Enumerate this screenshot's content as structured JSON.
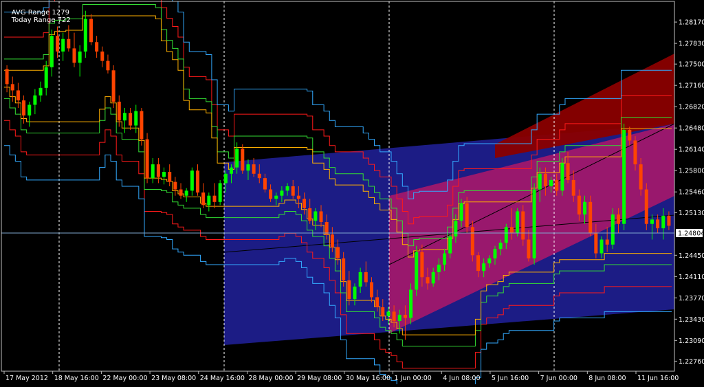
{
  "header": {
    "avg_range_label": "AVG Range 1279",
    "today_range_label": "Today Range 722"
  },
  "colors": {
    "background": "#000000",
    "frame": "#c0c0c0",
    "text": "#ffffff",
    "bull": "#00ff00",
    "bear": "#ff4400",
    "band_red": "#ff1a1a",
    "band_green": "#33dd33",
    "band_orange": "#ffb000",
    "band_blue": "#33aaff",
    "channel_blue": "#1e1e8c",
    "channel_pink": "#a0186c",
    "channel_red": "#8a0000",
    "current_price_line": "#7fa8d0"
  },
  "chart_data": {
    "type": "candlestick",
    "instrument_timeframe": "",
    "current_price": "1.24804",
    "y_ticks": [
      "1.28170",
      "1.27830",
      "1.27500",
      "1.27160",
      "1.26820",
      "1.26480",
      "1.26140",
      "1.25800",
      "1.25460",
      "1.25130",
      "1.24450",
      "1.24110",
      "1.23770",
      "1.23430",
      "1.23090",
      "1.22760"
    ],
    "ylim": [
      1.226,
      1.285
    ],
    "x_ticks": [
      "17 May 2012",
      "18 May 16:00",
      "22 May 00:00",
      "23 May 08:00",
      "24 May 16:00",
      "28 May 00:00",
      "29 May 08:00",
      "30 May 16:00",
      "1 Jun 00:00",
      "4 Jun 08:00",
      "5 Jun 16:00",
      "7 Jun 00:00",
      "8 Jun 08:00",
      "11 Jun 16:00"
    ],
    "candles": [
      [
        1.2742,
        1.2748,
        1.2705,
        1.2718
      ],
      [
        1.2718,
        1.273,
        1.269,
        1.2708
      ],
      [
        1.2708,
        1.272,
        1.268,
        1.2692
      ],
      [
        1.2692,
        1.27,
        1.2655,
        1.2668
      ],
      [
        1.2668,
        1.269,
        1.265,
        1.2685
      ],
      [
        1.2685,
        1.271,
        1.267,
        1.27
      ],
      [
        1.27,
        1.2722,
        1.269,
        1.2712
      ],
      [
        1.2712,
        1.2755,
        1.27,
        1.2745
      ],
      [
        1.2745,
        1.2805,
        1.273,
        1.2795
      ],
      [
        1.2795,
        1.281,
        1.276,
        1.277
      ],
      [
        1.277,
        1.28,
        1.2755,
        1.279
      ],
      [
        1.279,
        1.2812,
        1.277,
        1.2775
      ],
      [
        1.2775,
        1.28,
        1.2745,
        1.2752
      ],
      [
        1.2752,
        1.278,
        1.273,
        1.277
      ],
      [
        1.277,
        1.2835,
        1.276,
        1.2822
      ],
      [
        1.2822,
        1.283,
        1.278,
        1.2785
      ],
      [
        1.2785,
        1.2795,
        1.276,
        1.277
      ],
      [
        1.277,
        1.2778,
        1.2745,
        1.2755
      ],
      [
        1.2755,
        1.2765,
        1.2735,
        1.274
      ],
      [
        1.274,
        1.2748,
        1.268,
        1.269
      ],
      [
        1.269,
        1.27,
        1.265,
        1.266
      ],
      [
        1.266,
        1.268,
        1.264,
        1.2672
      ],
      [
        1.2672,
        1.268,
        1.2645,
        1.2652
      ],
      [
        1.2652,
        1.2685,
        1.264,
        1.2675
      ],
      [
        1.2675,
        1.268,
        1.262,
        1.263
      ],
      [
        1.263,
        1.264,
        1.256,
        1.2568
      ],
      [
        1.2568,
        1.26,
        1.256,
        1.259
      ],
      [
        1.259,
        1.26,
        1.256,
        1.257
      ],
      [
        1.257,
        1.2585,
        1.2558,
        1.2578
      ],
      [
        1.2578,
        1.259,
        1.2555,
        1.2562
      ],
      [
        1.2562,
        1.257,
        1.254,
        1.255
      ],
      [
        1.255,
        1.256,
        1.2535,
        1.254
      ],
      [
        1.254,
        1.2552,
        1.253,
        1.2548
      ],
      [
        1.2548,
        1.2585,
        1.254,
        1.258
      ],
      [
        1.258,
        1.259,
        1.254,
        1.2545
      ],
      [
        1.2545,
        1.256,
        1.252,
        1.2525
      ],
      [
        1.2525,
        1.2545,
        1.2515,
        1.254
      ],
      [
        1.254,
        1.256,
        1.252,
        1.253
      ],
      [
        1.253,
        1.2565,
        1.2525,
        1.256
      ],
      [
        1.256,
        1.258,
        1.2545,
        1.2575
      ],
      [
        1.2575,
        1.259,
        1.256,
        1.2585
      ],
      [
        1.2585,
        1.2625,
        1.2575,
        1.2615
      ],
      [
        1.2615,
        1.2622,
        1.2575,
        1.258
      ],
      [
        1.258,
        1.2598,
        1.2565,
        1.259
      ],
      [
        1.259,
        1.26,
        1.257,
        1.2575
      ],
      [
        1.2575,
        1.259,
        1.256,
        1.2568
      ],
      [
        1.2568,
        1.2575,
        1.2545,
        1.255
      ],
      [
        1.255,
        1.2558,
        1.253,
        1.2535
      ],
      [
        1.2535,
        1.2545,
        1.2525,
        1.254
      ],
      [
        1.254,
        1.2555,
        1.253,
        1.2548
      ],
      [
        1.2548,
        1.256,
        1.254,
        1.2555
      ],
      [
        1.2555,
        1.2565,
        1.2535,
        1.254
      ],
      [
        1.254,
        1.2555,
        1.252,
        1.2535
      ],
      [
        1.2535,
        1.2545,
        1.251,
        1.252
      ],
      [
        1.252,
        1.2535,
        1.2495,
        1.25
      ],
      [
        1.25,
        1.252,
        1.2485,
        1.2515
      ],
      [
        1.2515,
        1.2525,
        1.249,
        1.2498
      ],
      [
        1.2498,
        1.251,
        1.247,
        1.2478
      ],
      [
        1.2478,
        1.249,
        1.245,
        1.2458
      ],
      [
        1.2458,
        1.247,
        1.243,
        1.244
      ],
      [
        1.244,
        1.245,
        1.2395,
        1.2405
      ],
      [
        1.2405,
        1.242,
        1.2365,
        1.2375
      ],
      [
        1.2375,
        1.24,
        1.2365,
        1.2395
      ],
      [
        1.2395,
        1.2425,
        1.2385,
        1.2418
      ],
      [
        1.2418,
        1.2435,
        1.2395,
        1.2402
      ],
      [
        1.2402,
        1.241,
        1.237,
        1.2378
      ],
      [
        1.2378,
        1.239,
        1.2355,
        1.2362
      ],
      [
        1.2362,
        1.2375,
        1.234,
        1.2348
      ],
      [
        1.2348,
        1.2362,
        1.2335,
        1.2355
      ],
      [
        1.2355,
        1.2365,
        1.233,
        1.234
      ],
      [
        1.234,
        1.2358,
        1.232,
        1.235
      ],
      [
        1.235,
        1.2365,
        1.231,
        1.2345
      ],
      [
        1.2345,
        1.24,
        1.2335,
        1.239
      ],
      [
        1.239,
        1.246,
        1.238,
        1.245
      ],
      [
        1.245,
        1.2462,
        1.2395,
        1.241
      ],
      [
        1.241,
        1.2425,
        1.239,
        1.24
      ],
      [
        1.24,
        1.2425,
        1.2395,
        1.2418
      ],
      [
        1.2418,
        1.244,
        1.2405,
        1.243
      ],
      [
        1.243,
        1.2455,
        1.242,
        1.2448
      ],
      [
        1.2448,
        1.248,
        1.244,
        1.2475
      ],
      [
        1.2475,
        1.251,
        1.2465,
        1.25
      ],
      [
        1.25,
        1.2535,
        1.249,
        1.2528
      ],
      [
        1.2528,
        1.2538,
        1.248,
        1.249
      ],
      [
        1.249,
        1.25,
        1.2435,
        1.2445
      ],
      [
        1.2445,
        1.245,
        1.241,
        1.242
      ],
      [
        1.242,
        1.244,
        1.241,
        1.2432
      ],
      [
        1.2432,
        1.2445,
        1.2425,
        1.244
      ],
      [
        1.244,
        1.246,
        1.243,
        1.2455
      ],
      [
        1.2455,
        1.247,
        1.2445,
        1.2465
      ],
      [
        1.2465,
        1.2495,
        1.2455,
        1.249
      ],
      [
        1.249,
        1.252,
        1.247,
        1.248
      ],
      [
        1.248,
        1.252,
        1.2475,
        1.2515
      ],
      [
        1.2515,
        1.2525,
        1.246,
        1.247
      ],
      [
        1.247,
        1.2485,
        1.2435,
        1.244
      ],
      [
        1.244,
        1.256,
        1.243,
        1.255
      ],
      [
        1.255,
        1.2585,
        1.253,
        1.2575
      ],
      [
        1.2575,
        1.2585,
        1.254,
        1.2555
      ],
      [
        1.2555,
        1.257,
        1.2545,
        1.2565
      ],
      [
        1.2565,
        1.2575,
        1.254,
        1.2548
      ],
      [
        1.2548,
        1.26,
        1.254,
        1.2592
      ],
      [
        1.2592,
        1.261,
        1.256,
        1.2565
      ],
      [
        1.2565,
        1.258,
        1.253,
        1.254
      ],
      [
        1.254,
        1.255,
        1.25,
        1.251
      ],
      [
        1.251,
        1.254,
        1.2495,
        1.253
      ],
      [
        1.253,
        1.254,
        1.2475,
        1.248
      ],
      [
        1.248,
        1.2495,
        1.244,
        1.2448
      ],
      [
        1.2448,
        1.2475,
        1.244,
        1.247
      ],
      [
        1.247,
        1.249,
        1.245,
        1.2462
      ],
      [
        1.2462,
        1.252,
        1.2455,
        1.251
      ],
      [
        1.251,
        1.252,
        1.248,
        1.2495
      ],
      [
        1.2495,
        1.2655,
        1.2485,
        1.2645
      ],
      [
        1.2645,
        1.265,
        1.262,
        1.2628
      ],
      [
        1.2628,
        1.2635,
        1.258,
        1.259
      ],
      [
        1.259,
        1.26,
        1.254,
        1.255
      ],
      [
        1.255,
        1.256,
        1.2485,
        1.2495
      ],
      [
        1.2495,
        1.251,
        1.247,
        1.2502
      ],
      [
        1.2502,
        1.251,
        1.248,
        1.2488
      ],
      [
        1.2488,
        1.252,
        1.247,
        1.2508
      ],
      [
        1.2508,
        1.2515,
        1.2485,
        1.2492
      ]
    ]
  }
}
